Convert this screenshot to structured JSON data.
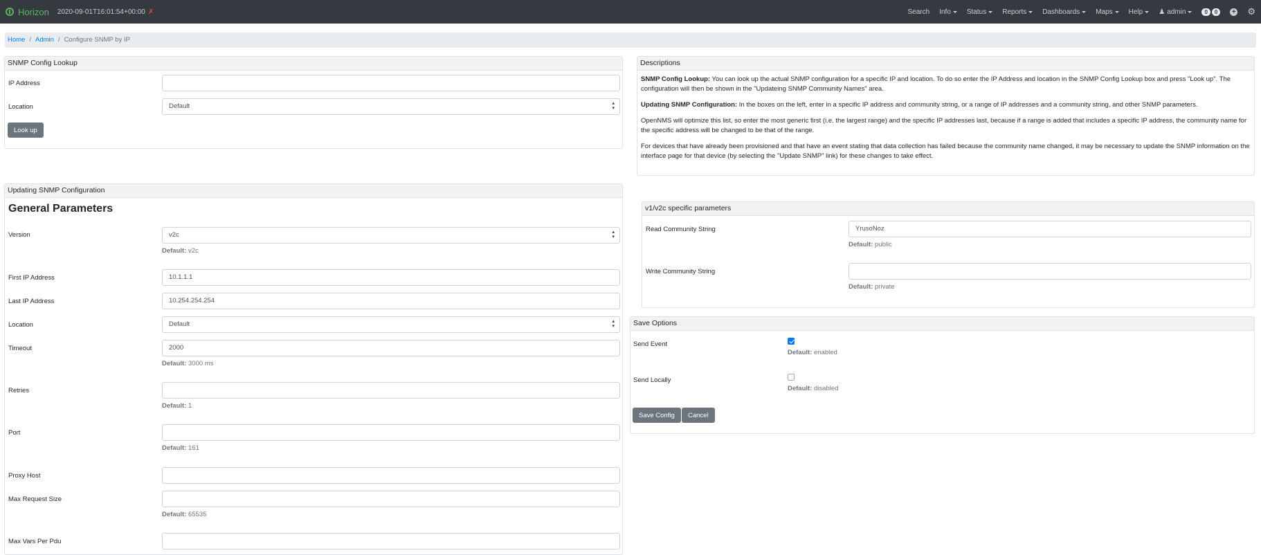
{
  "app": {
    "brand": "Horizon",
    "clock": "2020-09-01T16:01:54+00:00"
  },
  "nav": {
    "search": "Search",
    "info": "Info",
    "status": "Status",
    "reports": "Reports",
    "dashboards": "Dashboards",
    "maps": "Maps",
    "help": "Help",
    "user": "admin",
    "badge1": "0",
    "badge2": "0"
  },
  "breadcrumb": {
    "home": "Home",
    "admin": "Admin",
    "current": "Configure SNMP by IP"
  },
  "lookup": {
    "title": "SNMP Config Lookup",
    "ip_label": "IP Address",
    "ip_value": "",
    "location_label": "Location",
    "location_value": "Default",
    "button": "Look up"
  },
  "descriptions": {
    "title": "Descriptions",
    "p1_bold": "SNMP Config Lookup:",
    "p1": " You can look up the actual SNMP configuration for a specific IP and location. To do so enter the IP Address and location in the SNMP Config Lookup box and press \"Look up\". The configuration will then be shown in the \"Updateing SNMP Community Names\" area.",
    "p2_bold": "Updating SNMP Configuration:",
    "p2": " In the boxes on the left, enter in a specific IP address and community string, or a range of IP addresses and a community string, and other SNMP parameters.",
    "p3": "OpenNMS will optimize this list, so enter the most generic first (i.e. the largest range) and the specific IP addresses last, because if a range is added that includes a specific IP address, the community name for the specific address will be changed to be that of the range.",
    "p4": "For devices that have already been provisioned and that have an event stating that data collection has failed because the community name changed, it may be necessary to update the SNMP information on the interface page for that device (by selecting the \"Update SNMP\" link) for these changes to take effect."
  },
  "update": {
    "title": "Updating SNMP Configuration",
    "general": "General Parameters",
    "default_label": "Default:",
    "version_label": "Version",
    "version_value": "v2c",
    "version_default": "v2c",
    "first_ip_label": "First IP Address",
    "first_ip_value": "10.1.1.1",
    "last_ip_label": "Last IP Address",
    "last_ip_value": "10.254.254.254",
    "location_label": "Location",
    "location_value": "Default",
    "timeout_label": "Timeout",
    "timeout_value": "2000",
    "timeout_default": "3000 ms",
    "retries_label": "Retries",
    "retries_value": "",
    "retries_default": "1",
    "port_label": "Port",
    "port_value": "",
    "port_default": "161",
    "proxy_label": "Proxy Host",
    "proxy_value": "",
    "maxreq_label": "Max Request Size",
    "maxreq_value": "",
    "maxreq_default": "65535",
    "maxvars_label": "Max Vars Per Pdu",
    "maxvars_value": ""
  },
  "v1v2c": {
    "title": "v1/v2c specific parameters",
    "read_label": "Read Community String",
    "read_value": "YrusoNoz",
    "read_default": "public",
    "write_label": "Write Community String",
    "write_value": "",
    "write_default": "private"
  },
  "save": {
    "title": "Save Options",
    "send_event_label": "Send Event",
    "send_event_checked": true,
    "send_event_default": "enabled",
    "send_locally_label": "Send Locally",
    "send_locally_checked": false,
    "send_locally_default": "disabled",
    "save_button": "Save Config",
    "cancel_button": "Cancel"
  }
}
